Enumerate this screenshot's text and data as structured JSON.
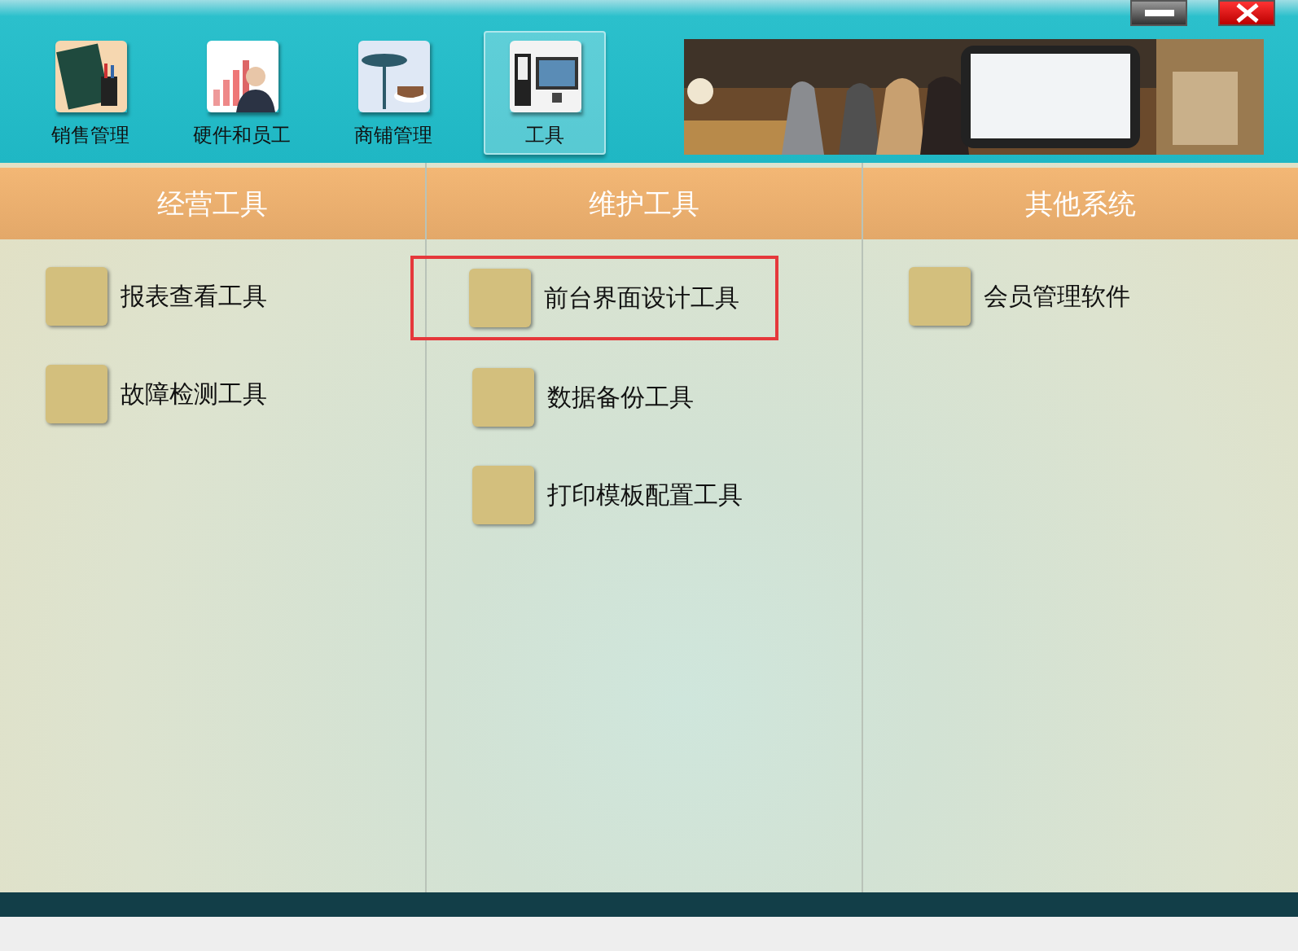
{
  "nav": [
    {
      "label": "销售管理",
      "selected": false,
      "kind": "book"
    },
    {
      "label": "硬件和员工",
      "selected": false,
      "kind": "chart"
    },
    {
      "label": "商铺管理",
      "selected": false,
      "kind": "cafe"
    },
    {
      "label": "工具",
      "selected": true,
      "kind": "computer"
    }
  ],
  "columns": [
    {
      "title": "经营工具",
      "items": [
        {
          "label": "报表查看工具",
          "selected": false
        },
        {
          "label": "故障检测工具",
          "selected": false
        }
      ]
    },
    {
      "title": "维护工具",
      "items": [
        {
          "label": "前台界面设计工具",
          "selected": true
        },
        {
          "label": "数据备份工具",
          "selected": false
        },
        {
          "label": "打印模板配置工具",
          "selected": false
        }
      ]
    },
    {
      "title": "其他系统",
      "items": [
        {
          "label": "会员管理软件",
          "selected": false
        }
      ]
    }
  ]
}
